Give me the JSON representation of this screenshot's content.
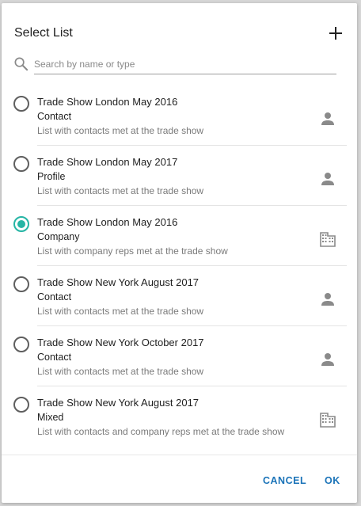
{
  "dialog": {
    "title": "Select List",
    "search_placeholder": "Search by name or type",
    "cancel_label": "CANCEL",
    "ok_label": "OK"
  },
  "colors": {
    "accent": "#26b5a5",
    "button_text": "#1a73b8"
  },
  "lists": [
    {
      "name": "Trade Show London May 2016",
      "type": "Contact",
      "description": "List with contacts met at the trade show",
      "icon": "person-icon",
      "selected": false
    },
    {
      "name": "Trade Show London May 2017",
      "type": "Profile",
      "description": "List with contacts met at the trade show",
      "icon": "person-icon",
      "selected": false
    },
    {
      "name": "Trade Show London May 2016",
      "type": "Company",
      "description": "List with company reps  met at the trade show",
      "icon": "building-icon",
      "selected": true
    },
    {
      "name": "Trade Show New York August 2017",
      "type": "Contact",
      "description": "List with contacts met at the trade show",
      "icon": "person-icon",
      "selected": false
    },
    {
      "name": "Trade Show New York October 2017",
      "type": "Contact",
      "description": "List with contacts met at the trade show",
      "icon": "person-icon",
      "selected": false
    },
    {
      "name": "Trade Show New York August 2017",
      "type": "Mixed",
      "description": "List with contacts and company reps met at the trade show",
      "icon": "building-icon",
      "selected": false
    }
  ]
}
